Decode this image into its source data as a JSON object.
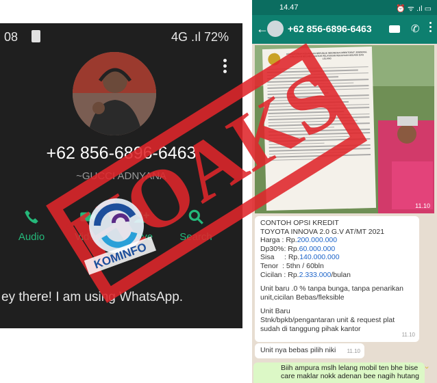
{
  "left": {
    "status": {
      "time": "08",
      "right": "4G .ıl 72%"
    },
    "number": "+62 856-6896-6463",
    "name": "~GUCCI ADNYANA",
    "actions": [
      {
        "label": "Audio",
        "icon": "phone-icon"
      },
      {
        "label": "Video",
        "icon": "video-icon"
      },
      {
        "label": "Save",
        "icon": "person-add-icon"
      },
      {
        "label": "Search",
        "icon": "search-icon"
      }
    ],
    "about": "ey there! I am using WhatsApp."
  },
  "right": {
    "status": {
      "time": "14.47",
      "right": "⏰ ᯤ .ıl ▭"
    },
    "header": {
      "number": "+62 856-6896-6463"
    },
    "photo": {
      "doc_header": "KEMENTERIAN KEUANGAN REPUBLIK INDONESIA\nDIREKTORAT JENDERAL KEKAYAAN NEGARA\nKANTOR PELAYANAN KEKAYAAN NEGARA DAN LELANG",
      "time": "11.10"
    },
    "credit_message": {
      "lines": [
        "CONTOH OPSI KREDIT",
        "TOYOTA INNOVA 2.0 G.V  AT/MT 2021"
      ],
      "harga_label": "Harga : Rp.",
      "harga_value": "200.000.000",
      "dp_label": "Dp30%: Rp.",
      "dp_value": "60.000.000",
      "sisa_label": "Sisa     : Rp.",
      "sisa_value": "140.000.000",
      "tenor": "Tenor  : 5thn / 60bln",
      "cicilan_label": "Cicilan : Rp.",
      "cicilan_value": "2.333.000",
      "cicilan_unit": "/bulan",
      "unit_baru_1": "Unit baru .0 % tanpa bunga, tanpa penarikan unit,cicilan Bebas/fleksible",
      "unit_baru_2_title": "Unit Baru",
      "unit_baru_2_body": "Stnk/bpkb/pengantaran unit & request plat sudah di tanggung pihak kantor",
      "time": "11.10"
    },
    "short_message": {
      "text": "Unit nya bebas pilih niki",
      "time": "11.10"
    },
    "outgoing": {
      "text": "Biih ampura mslh lelang mobil ten bhe bise care maklar nokk adenan bee nagih hutang"
    }
  },
  "overlay": {
    "stamp_text": "HOAKS",
    "logo_text": "KOMINFO",
    "stamp_color": "#e0262b"
  }
}
